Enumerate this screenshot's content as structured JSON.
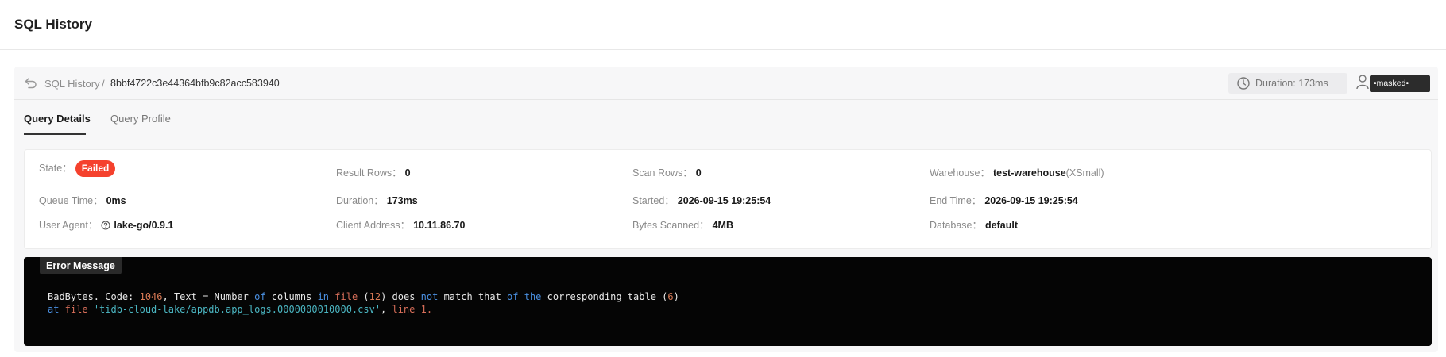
{
  "page": {
    "title": "SQL History"
  },
  "breadcrumb": {
    "parent": "SQL History",
    "separator": "/",
    "query_id": "8bbf4722c3e44364bfb9c82acc583940"
  },
  "meta": {
    "duration": "Duration: 173ms",
    "user": "•masked•"
  },
  "tabs": [
    {
      "label": "Query Details",
      "active": true
    },
    {
      "label": "Query Profile",
      "active": false
    }
  ],
  "details": {
    "state": {
      "label": "State：",
      "value": "Failed",
      "color": "#f5412d"
    },
    "result_rows": {
      "label": "Result Rows：",
      "value": "0"
    },
    "scan_rows": {
      "label": "Scan Rows：",
      "value": "0"
    },
    "warehouse": {
      "label": "Warehouse：",
      "value": "test-warehouse",
      "size": "(XSmall)"
    },
    "queue_time": {
      "label": "Queue Time：",
      "value": "0ms"
    },
    "duration": {
      "label": "Duration：",
      "value": "173ms"
    },
    "started": {
      "label": "Started：",
      "value": "2026-09-15 19:25:54"
    },
    "end_time": {
      "label": "End Time：",
      "value": "2026-09-15 19:25:54"
    },
    "user_agent": {
      "label": "User Agent：",
      "value": "lake-go/0.9.1"
    },
    "client_address": {
      "label": "Client Address：",
      "value": "10.11.86.70"
    },
    "bytes_scanned": {
      "label": "Bytes Scanned：",
      "value": "4MB"
    },
    "database": {
      "label": "Database：",
      "value": "default"
    }
  },
  "error": {
    "title": "Error Message",
    "line1": {
      "a": "BadBytes. Code: ",
      "code": "1046",
      "b": ", Text = Number ",
      "of1": "of",
      "c": " columns ",
      "in": "in",
      "d": " ",
      "file": "file",
      "e": " (",
      "n12": "12",
      "f": ") does ",
      "not": "not",
      "g": " match that ",
      "of2": "of",
      "h": " ",
      "the": "the",
      "i": " corresponding table (",
      "n6": "6",
      "j": ")"
    },
    "line2": {
      "at": "at",
      "file": " file ",
      "path": "'tidb-cloud-lake/appdb.app_logs.0000000010000.csv'",
      "sep": ", ",
      "line": "line 1."
    }
  },
  "colors": {
    "accent_failed": "#f5412d",
    "keyword": "#4a90e2",
    "number": "#d97a55",
    "identifier": "#4bb6c2"
  }
}
